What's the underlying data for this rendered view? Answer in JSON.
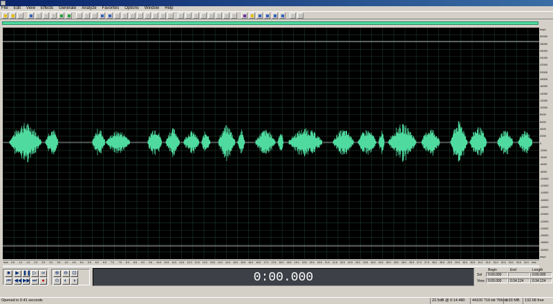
{
  "window": {
    "title": ""
  },
  "menu": [
    "File",
    "Edit",
    "View",
    "Effects",
    "Generate",
    "Analyze",
    "Favorites",
    "Options",
    "Window",
    "Help"
  ],
  "toolbar": {
    "button_count": 38
  },
  "colors": {
    "waveform": "#4fdb9f",
    "background": "#000000",
    "grid": "#1f3a2c",
    "center_line": "#c8c8c8",
    "limit_line": "#b0b0b0",
    "time_display_bg": "#3d4047"
  },
  "vertical_ruler": {
    "labels": [
      "smpl",
      "30000",
      "28000",
      "26000",
      "24000",
      "22000",
      "20000",
      "18000",
      "16000",
      "14000",
      "12000",
      "10000",
      "8000",
      "6000",
      "4000",
      "2000",
      "0",
      "-2000",
      "-4000",
      "-6000",
      "-8000",
      "-10000",
      "-12000",
      "-14000",
      "-16000",
      "-18000",
      "-20000",
      "-22000",
      "-24000",
      "-26000",
      "-28000",
      "-30000",
      "smpl"
    ]
  },
  "horizontal_ruler": {
    "labels": [
      "hms",
      "0.5",
      "1.0",
      "1.5",
      "2.0",
      "2.5",
      "3.0",
      "3.5",
      "4.0",
      "4.5",
      "5.0",
      "5.5",
      "6.0",
      "6.5",
      "7.0",
      "7.5",
      "8.0",
      "8.5",
      "9.0",
      "9.5",
      "10.0",
      "10.5",
      "11.0",
      "11.5",
      "12.0",
      "12.5",
      "13.0",
      "13.5",
      "14.0",
      "14.5",
      "15.0",
      "15.5",
      "16.0",
      "16.5",
      "17.0",
      "17.5",
      "18.0",
      "18.5",
      "19.0",
      "19.5",
      "20.0",
      "20.5",
      "21.0",
      "21.5",
      "22.0",
      "22.5",
      "23.0",
      "23.5",
      "24.0",
      "24.5",
      "25.0",
      "25.5",
      "26.0",
      "26.5",
      "27.0",
      "27.5",
      "28.0",
      "28.5",
      "29.0",
      "29.5",
      "30.0",
      "30.5",
      "31.0",
      "31.5",
      "32.0",
      "32.5",
      "33.0",
      "33.5",
      "34.0",
      "hms"
    ]
  },
  "transport": {
    "buttons": [
      {
        "name": "stop-button",
        "glyph": "■"
      },
      {
        "name": "play-button",
        "glyph": "▶"
      },
      {
        "name": "pause-button",
        "glyph": "❚❚"
      },
      {
        "name": "play-to-end-button",
        "glyph": "▷"
      },
      {
        "name": "loop-button",
        "glyph": "∞"
      },
      {
        "name": "go-start-button",
        "glyph": "⏮"
      },
      {
        "name": "rewind-button",
        "glyph": "◀◀"
      },
      {
        "name": "forward-button",
        "glyph": "▶▶"
      },
      {
        "name": "go-end-button",
        "glyph": "⏭"
      },
      {
        "name": "record-button",
        "glyph": "●"
      }
    ]
  },
  "zoom": {
    "buttons": [
      {
        "name": "zoom-in-button",
        "glyph": "⊕"
      },
      {
        "name": "zoom-out-button",
        "glyph": "⊖"
      },
      {
        "name": "zoom-full-button",
        "glyph": "⊡"
      },
      {
        "name": "zoom-selection-button",
        "glyph": "⊙"
      },
      {
        "name": "zoom-left-button",
        "glyph": "◐"
      },
      {
        "name": "zoom-right-button",
        "glyph": "◑"
      }
    ]
  },
  "time_display": {
    "value": "0:00.000"
  },
  "selection": {
    "headers": [
      "Begin",
      "End",
      "Length"
    ],
    "rows": [
      {
        "label": "Sel",
        "begin": "0:00.000",
        "end": "",
        "length": "0:00.000"
      },
      {
        "label": "View",
        "begin": "0:00.000",
        "end": "0:34.124",
        "length": "0:34.124"
      }
    ]
  },
  "status": {
    "message": "Opened in 0.41 seconds",
    "level": "22.5dB @ 0:14.480",
    "format": "44100 ?16-bit ?Mono",
    "size": "2.93 MB",
    "free": "132.58 free"
  }
}
